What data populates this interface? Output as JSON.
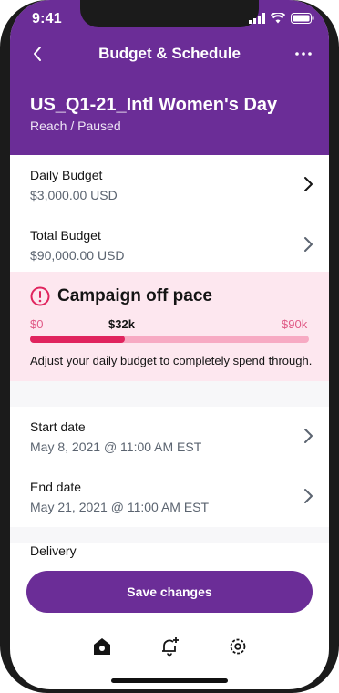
{
  "status": {
    "time": "9:41"
  },
  "header": {
    "title": "Budget & Schedule",
    "campaign_name": "US_Q1-21_Intl Women's Day",
    "campaign_status": "Reach / Paused"
  },
  "budget": {
    "daily_label": "Daily Budget",
    "daily_value": "$3,000.00 USD",
    "total_label": "Total Budget",
    "total_value": "$90,000.00 USD"
  },
  "alert": {
    "title": "Campaign off pace",
    "min_label": "$0",
    "current_label": "$32k",
    "max_label": "$90k",
    "progress": 0.34,
    "message": "Adjust your daily budget to completely spend through."
  },
  "schedule": {
    "start_label": "Start date",
    "start_value": "May 8, 2021 @ 11:00 AM EST",
    "end_label": "End date",
    "end_value": "May 21, 2021 @ 11:00 AM EST"
  },
  "delivery": {
    "label": "Delivery"
  },
  "actions": {
    "save_label": "Save changes"
  },
  "tabs": [
    "home-icon",
    "notifications-icon",
    "settings-icon"
  ],
  "colors": {
    "brand": "#6b2d97",
    "alert_bg": "#fde7ef",
    "alert_red": "#e0245e"
  }
}
